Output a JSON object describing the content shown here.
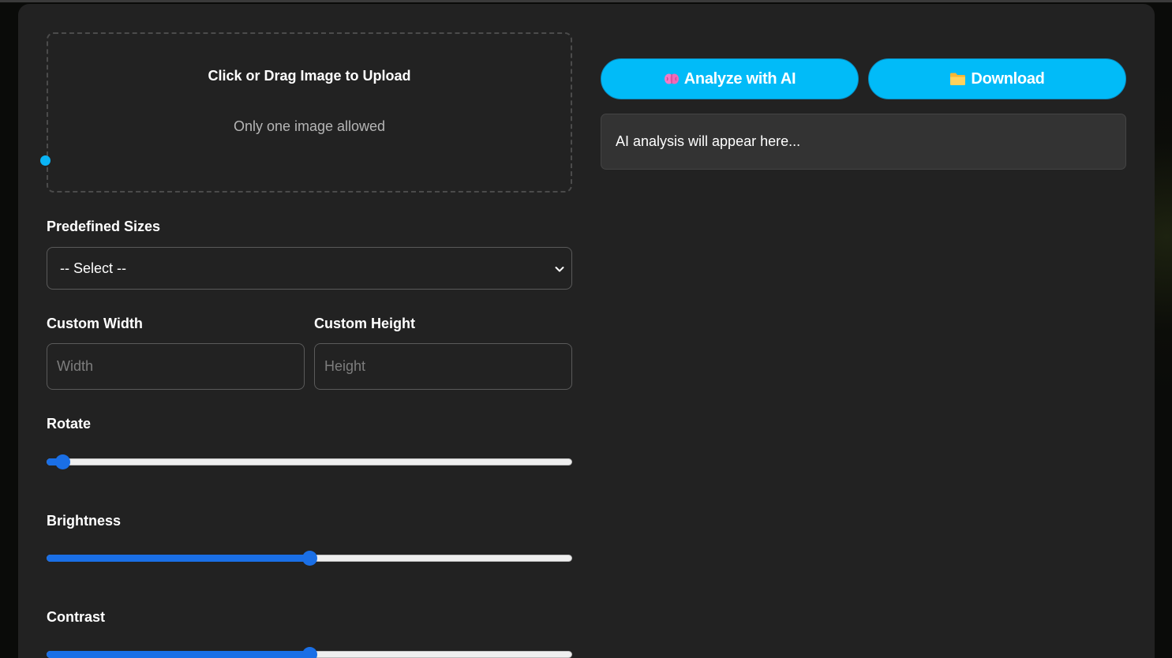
{
  "upload": {
    "title": "Click or Drag Image to Upload",
    "subtitle": "Only one image allowed"
  },
  "sizes": {
    "label": "Predefined Sizes",
    "selected": "-- Select --"
  },
  "custom": {
    "width_label": "Custom Width",
    "height_label": "Custom Height",
    "width_placeholder": "Width",
    "height_placeholder": "Height"
  },
  "rotate": {
    "label": "Rotate",
    "value": 0.03
  },
  "brightness": {
    "label": "Brightness",
    "value": 0.5
  },
  "contrast": {
    "label": "Contrast",
    "value": 0.5
  },
  "actions": {
    "analyze_label": "Analyze with AI",
    "analyze_icon": "brain-icon",
    "download_label": "Download",
    "download_icon": "folder-icon"
  },
  "analysis": {
    "placeholder_text": "AI analysis will appear here..."
  },
  "colors": {
    "accent": "#01bbf8",
    "slider": "#1a6fe6",
    "panel": "#222222"
  }
}
